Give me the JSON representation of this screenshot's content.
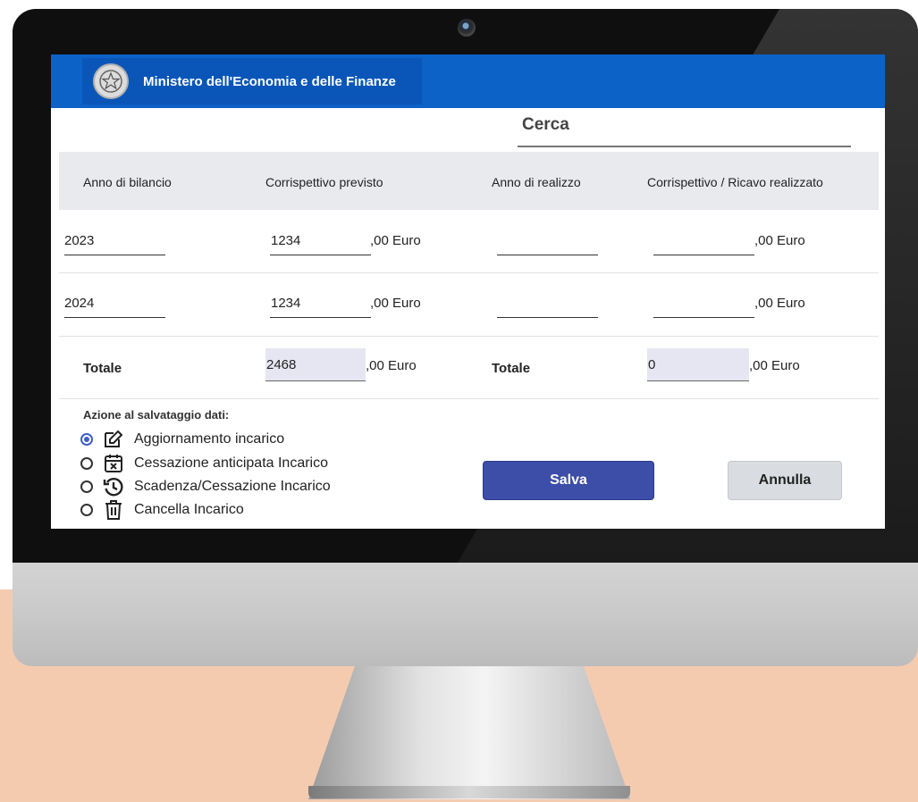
{
  "header": {
    "title": "Ministero dell'Economia e delle Finanze"
  },
  "search": {
    "label": "Cerca"
  },
  "table": {
    "columns": [
      "Anno di bilancio",
      "Corrispettivo previsto",
      "Anno di realizzo",
      "Corrispettivo / Ricavo realizzato"
    ],
    "rows": [
      {
        "anno": "2023",
        "previsto": "1234",
        "previsto_suffix": ",00 Euro",
        "anno_realizzo": "",
        "realizzato": "",
        "realizzato_suffix": ",00 Euro"
      },
      {
        "anno": "2024",
        "previsto": "1234",
        "previsto_suffix": ",00 Euro",
        "anno_realizzo": "",
        "realizzato": "",
        "realizzato_suffix": ",00 Euro"
      }
    ],
    "totals": {
      "label_left": "Totale",
      "previsto": "2468",
      "previsto_suffix": ",00 Euro",
      "label_right": "Totale",
      "realizzato": "0",
      "realizzato_suffix": ",00 Euro"
    }
  },
  "save_action": {
    "title": "Azione al salvataggio dati:",
    "options": [
      {
        "label": "Aggiornamento incarico",
        "icon": "edit-icon",
        "checked": true
      },
      {
        "label": "Cessazione anticipata Incarico",
        "icon": "calendar-x-icon",
        "checked": false
      },
      {
        "label": "Scadenza/Cessazione Incarico",
        "icon": "history-icon",
        "checked": false
      },
      {
        "label": "Cancella Incarico",
        "icon": "trash-icon",
        "checked": false
      }
    ]
  },
  "buttons": {
    "save": "Salva",
    "cancel": "Annulla"
  },
  "colors": {
    "header": "#0d62c8",
    "primary_button": "#3c4ea8",
    "secondary_button": "#d9dde2",
    "radio_selected": "#3c5fc9"
  }
}
